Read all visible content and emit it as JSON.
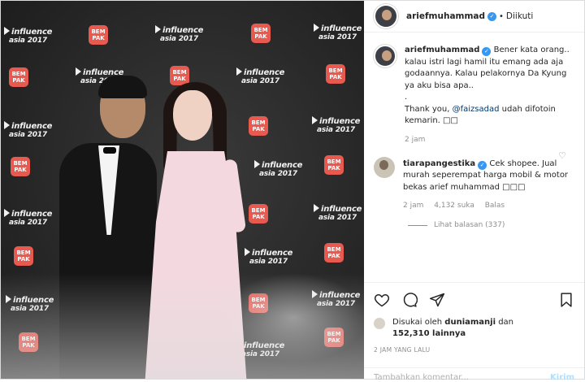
{
  "photo": {
    "logos": [
      "influence",
      "asia 2017"
    ],
    "bempak": [
      "BEM",
      "PAK"
    ]
  },
  "header": {
    "username": "ariefmuhammad",
    "separator": "•",
    "follow_status": "Diikuti"
  },
  "caption": {
    "username": "ariefmuhammad",
    "text_part1": "Bener kata orang.. kalau istri lagi hamil itu emang ada aja godaannya. Kalau pelakornya Da Kyung ya aku bisa apa..",
    "text_dot": ".",
    "text_part2_prefix": "Thank you, ",
    "mention": "@faizsadad",
    "text_part2_suffix": " udah difotoin kemarin. □□",
    "time": "2 jam"
  },
  "comment": {
    "username": "tiarapangestika",
    "text": "Cek shopee. Jual murah seperempat harga mobil & motor bekas arief muhammad □□□",
    "time": "2 jam",
    "likes": "4,132 suka",
    "reply": "Balas",
    "view_replies": "Lihat balasan (337)"
  },
  "actions": {
    "liked_by_prefix": "Disukai oleh ",
    "liked_by_user": "duniamanji",
    "liked_by_and": " dan",
    "liked_by_count": "152,310 lainnya",
    "timestamp": "2 JAM YANG LALU"
  },
  "add_comment": {
    "placeholder": "Tambahkan komentar...",
    "send_label": "Kirim"
  },
  "colors": {
    "link": "#00376b",
    "verified": "#3897f0",
    "send_disabled": "#b2dffc"
  }
}
